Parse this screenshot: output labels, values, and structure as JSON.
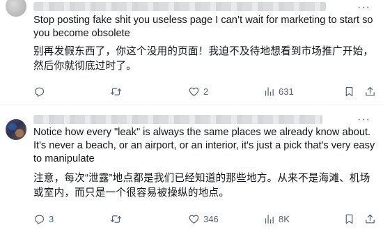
{
  "posts": [
    {
      "text_en": "Stop posting fake shit you useless page I can’t wait for marketing to start so you become obsolete",
      "text_zh": "别再发假东西了，你这个没用的页面！我迫不及待地想看到市场推广开始，然后你就彻底过时了。",
      "reply_count": "",
      "retweet_count": "",
      "like_count": "2",
      "view_count": "631"
    },
    {
      "text_en": "Notice how every \"leak\" is always the same places we already know about. It's never a beach, or an airport, or an interior, it's just a pick that's very easy to manipulate",
      "text_zh": "注意，每次“泄露”地点都是我们已经知道的那些地方。从来不是海滩、机场或室内，而只是一个很容易被操纵的地点。",
      "reply_count": "3",
      "retweet_count": "",
      "like_count": "346",
      "view_count": "8K"
    }
  ],
  "icons": {
    "more": "more-icon",
    "reply": "reply-icon",
    "retweet": "retweet-icon",
    "like": "heart-icon",
    "views": "views-icon",
    "bookmark": "bookmark-icon",
    "share": "share-icon"
  },
  "colors": {
    "text": "#0f1419",
    "secondary": "#536471",
    "divider": "#eff3f4"
  }
}
